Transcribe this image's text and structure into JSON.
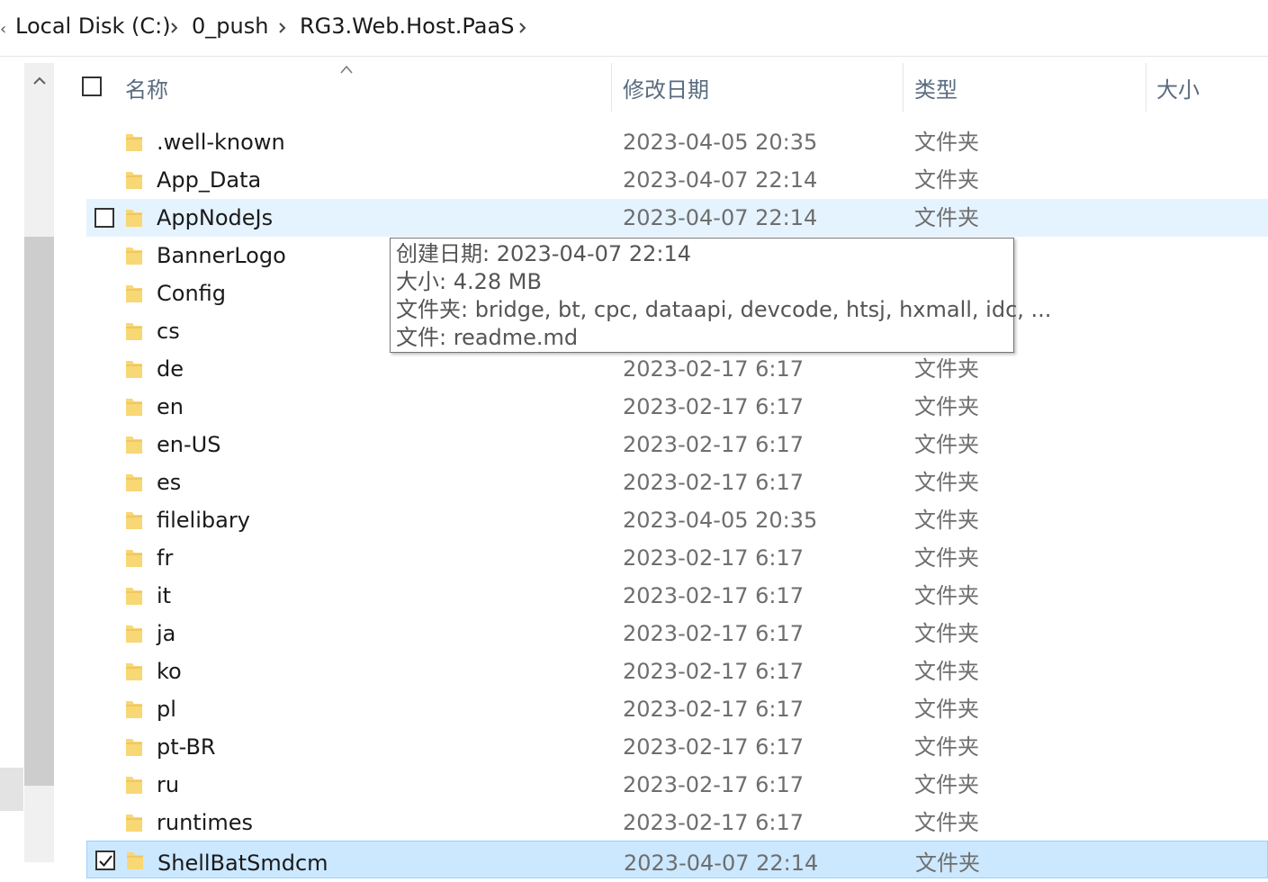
{
  "breadcrumb": {
    "items": [
      "Local Disk (C:)",
      "0_push",
      "RG3.Web.Host.PaaS"
    ]
  },
  "columns": {
    "name": "名称",
    "modified": "修改日期",
    "type": "类型",
    "size": "大小"
  },
  "rows": [
    {
      "name": ".well-known",
      "date": "2023-04-05 20:35",
      "type": "文件夹"
    },
    {
      "name": "App_Data",
      "date": "2023-04-07 22:14",
      "type": "文件夹"
    },
    {
      "name": "AppNodeJs",
      "date": "2023-04-07 22:14",
      "type": "文件夹"
    },
    {
      "name": "BannerLogo",
      "date": "",
      "type": ""
    },
    {
      "name": "Config",
      "date": "",
      "type": ""
    },
    {
      "name": "cs",
      "date": "",
      "type": ""
    },
    {
      "name": "de",
      "date": "2023-02-17 6:17",
      "type": "文件夹"
    },
    {
      "name": "en",
      "date": "2023-02-17 6:17",
      "type": "文件夹"
    },
    {
      "name": "en-US",
      "date": "2023-02-17 6:17",
      "type": "文件夹"
    },
    {
      "name": "es",
      "date": "2023-02-17 6:17",
      "type": "文件夹"
    },
    {
      "name": "filelibary",
      "date": "2023-04-05 20:35",
      "type": "文件夹"
    },
    {
      "name": "fr",
      "date": "2023-02-17 6:17",
      "type": "文件夹"
    },
    {
      "name": "it",
      "date": "2023-02-17 6:17",
      "type": "文件夹"
    },
    {
      "name": "ja",
      "date": "2023-02-17 6:17",
      "type": "文件夹"
    },
    {
      "name": "ko",
      "date": "2023-02-17 6:17",
      "type": "文件夹"
    },
    {
      "name": "pl",
      "date": "2023-02-17 6:17",
      "type": "文件夹"
    },
    {
      "name": "pt-BR",
      "date": "2023-02-17 6:17",
      "type": "文件夹"
    },
    {
      "name": "ru",
      "date": "2023-02-17 6:17",
      "type": "文件夹"
    },
    {
      "name": "runtimes",
      "date": "2023-02-17 6:17",
      "type": "文件夹"
    },
    {
      "name": "ShellBatSmdcm",
      "date": "2023-04-07 22:14",
      "type": "文件夹"
    }
  ],
  "tooltip": {
    "created": "创建日期: 2023-04-07 22:14",
    "size": "大小: 4.28 MB",
    "folders": "文件夹: bridge, bt, cpc, dataapi, devcode, htsj, hxmall, idc, ...",
    "files": "文件: readme.md"
  },
  "colors": {
    "hover_row": "#e5f3ff",
    "selected_row": "#cce8ff",
    "folder_yellow": "#f8d775",
    "header_text": "#5a6b80"
  }
}
